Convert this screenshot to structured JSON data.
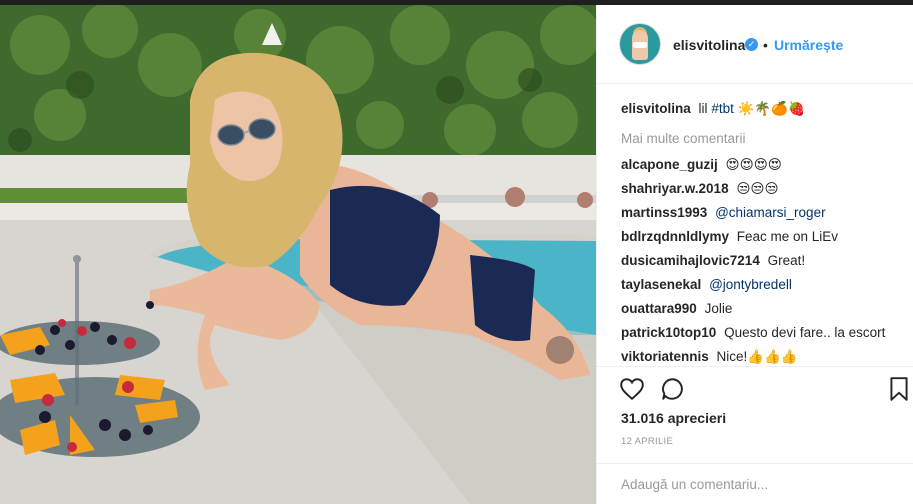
{
  "post": {
    "username": "elisvitolina",
    "verified_badge": "✓",
    "dot": "•",
    "follow_label": "Urmărește"
  },
  "caption": {
    "username": "elisvitolina",
    "text": "lil",
    "hashtag": "#tbt",
    "emoji": "☀️🌴🍊🍓"
  },
  "more_comments_label": "Mai multe comentarii",
  "comments": [
    {
      "username": "alcapone_guzij",
      "text": "😍😍😍😍"
    },
    {
      "username": "shahriyar.w.2018",
      "text": "😒😒😒"
    },
    {
      "username": "martinss1993",
      "mention": "@chiamarsi_roger",
      "text": ""
    },
    {
      "username": "bdlrzqdnnldlymy",
      "text": "Feac me on LiEv"
    },
    {
      "username": "dusicamihajlovic7214",
      "text": "Great!"
    },
    {
      "username": "taylasenekal",
      "mention": "@jontybredell",
      "text": ""
    },
    {
      "username": "ouattara990",
      "text": "Jolie"
    },
    {
      "username": "patrick10top10",
      "text": "Questo devi fare.. la escort"
    },
    {
      "username": "viktoriatennis",
      "text": "Nice!👍👍👍"
    }
  ],
  "icons": {
    "like": "heart-icon",
    "comment": "comment-icon",
    "save": "bookmark-icon"
  },
  "likes_label": "31.016 aprecieri",
  "date_label": "12 APRILIE",
  "comment_placeholder": "Adaugă un comentariu...",
  "colors": {
    "link_blue": "#3897f0",
    "mention_blue": "#003569",
    "muted": "#999999",
    "text": "#262626"
  }
}
